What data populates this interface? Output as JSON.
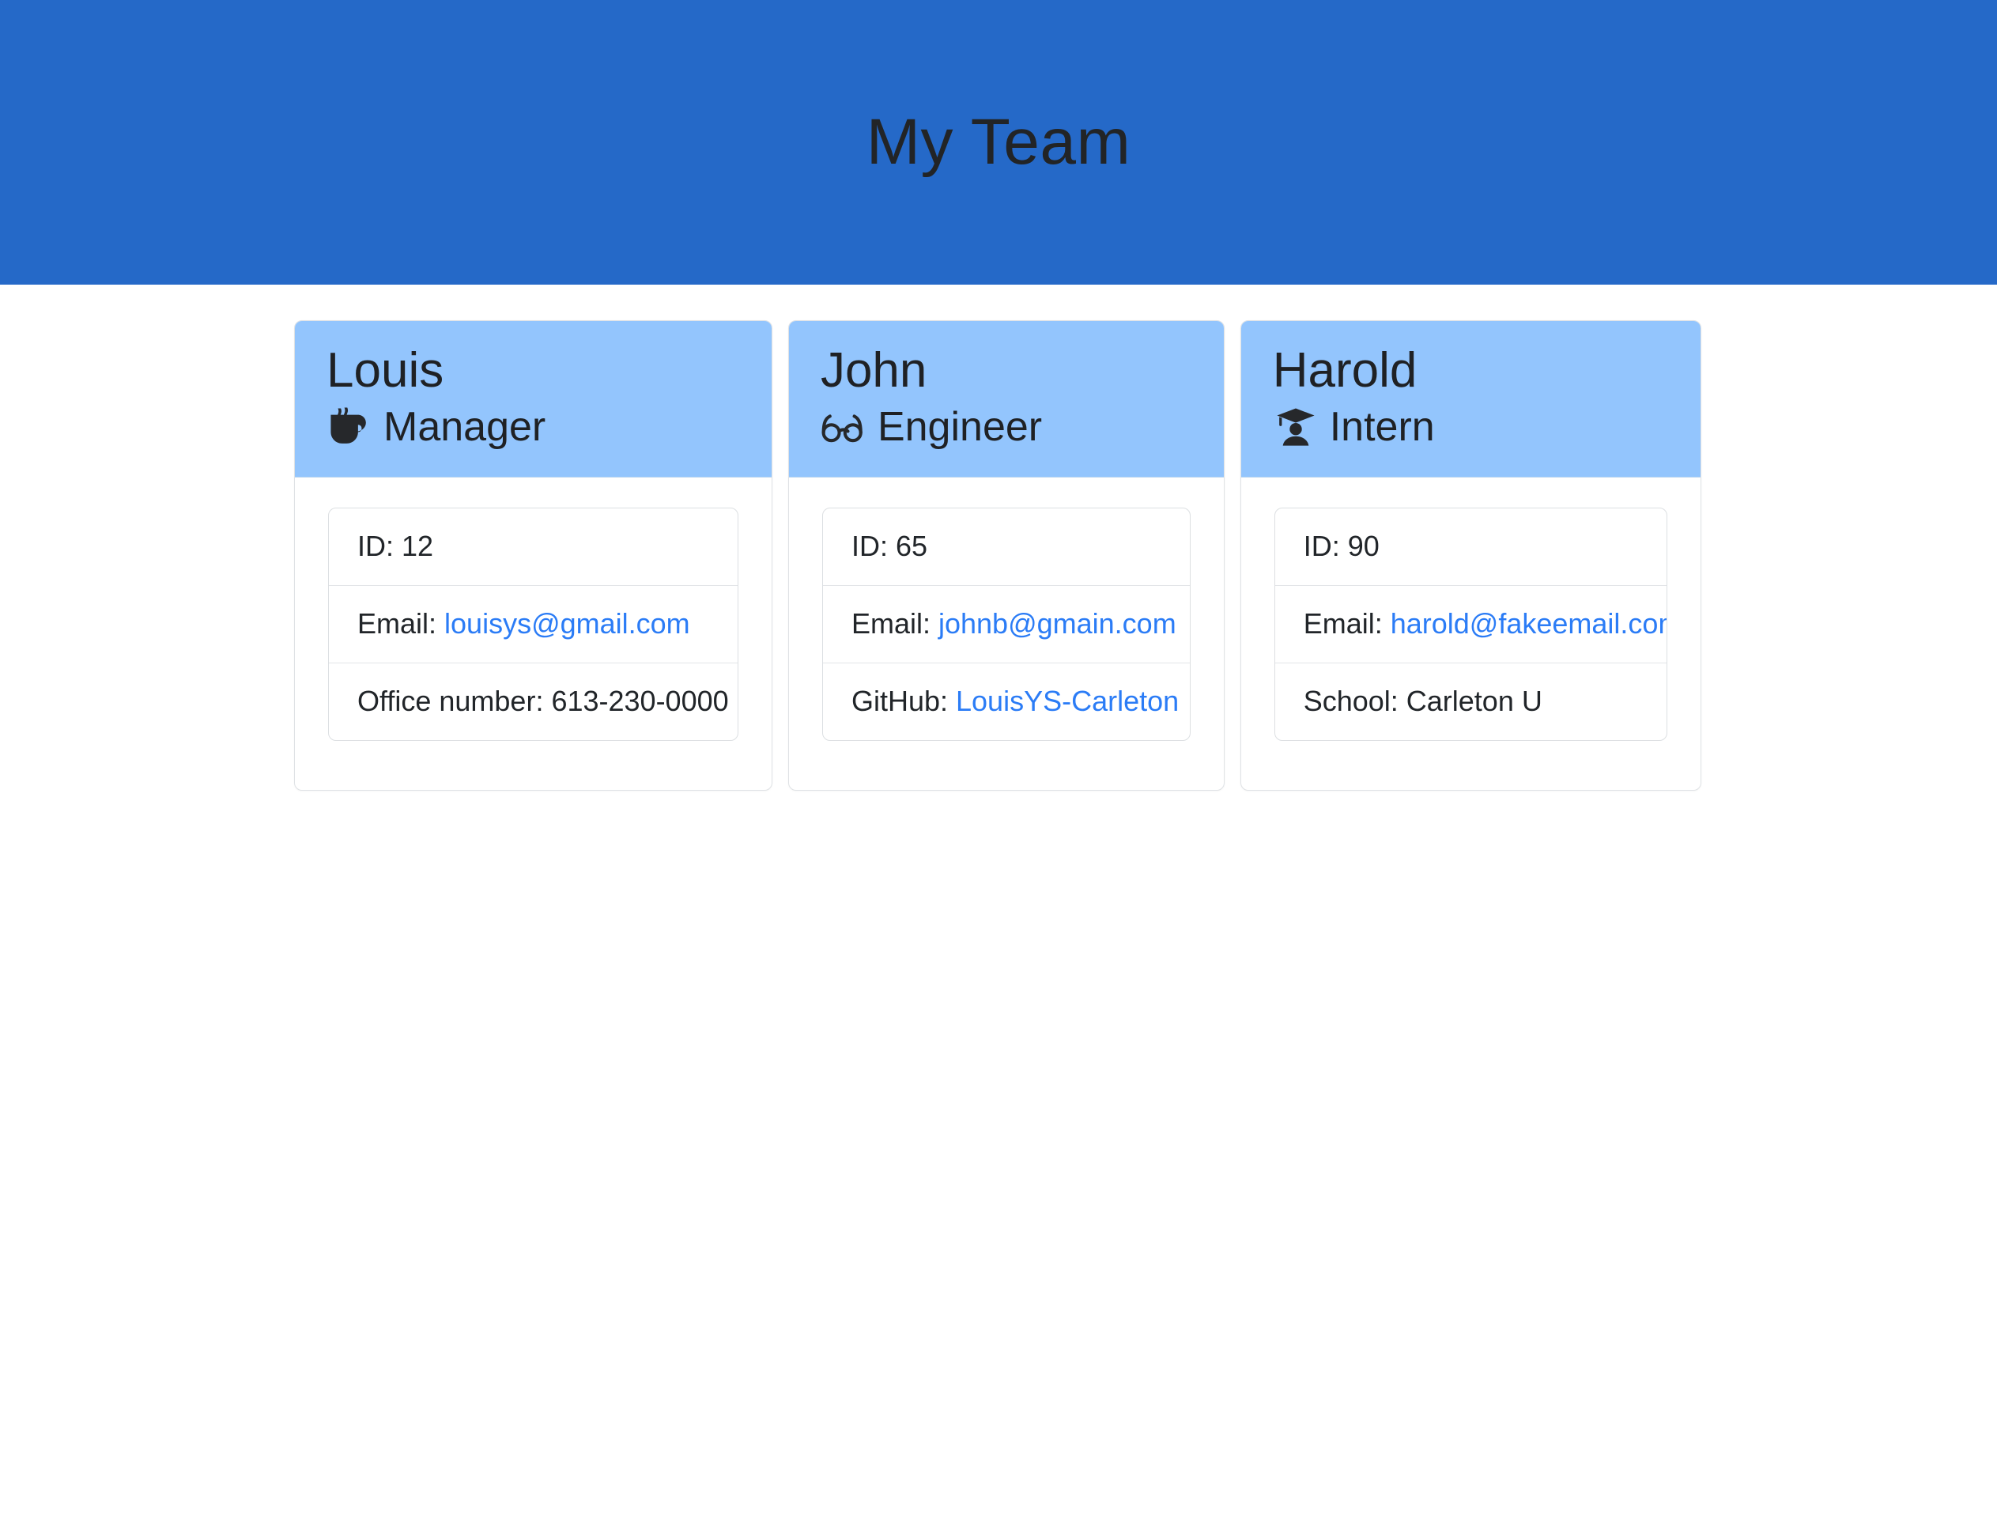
{
  "banner": {
    "title": "My Team",
    "background_color": "#2569c8",
    "title_color": "#222426"
  },
  "theme": {
    "card_header_color": "#93c5fd",
    "link_color": "#2b7cf6",
    "card_border_color": "#dfe2e5",
    "page_background": "#ffffff"
  },
  "cards": [
    {
      "name": "Louis",
      "role": "Manager",
      "role_icon": "coffee-cup-icon",
      "details": [
        {
          "label": "ID:",
          "value": "12",
          "is_link": false
        },
        {
          "label": "Email:",
          "value": "louisys@gmail.com",
          "is_link": true
        },
        {
          "label": "Office number:",
          "value": "613-230-0000",
          "is_link": false
        }
      ]
    },
    {
      "name": "John",
      "role": "Engineer",
      "role_icon": "eyeglasses-icon",
      "details": [
        {
          "label": "ID:",
          "value": "65",
          "is_link": false
        },
        {
          "label": "Email:",
          "value": "johnb@gmain.com",
          "is_link": true
        },
        {
          "label": "GitHub:",
          "value": "LouisYS-Carleton",
          "is_link": true
        }
      ]
    },
    {
      "name": "Harold",
      "role": "Intern",
      "role_icon": "graduate-student-icon",
      "details": [
        {
          "label": "ID:",
          "value": "90",
          "is_link": false
        },
        {
          "label": "Email:",
          "value": "harold@fakeemail.com",
          "is_link": true
        },
        {
          "label": "School:",
          "value": "Carleton U",
          "is_link": false
        }
      ]
    }
  ]
}
